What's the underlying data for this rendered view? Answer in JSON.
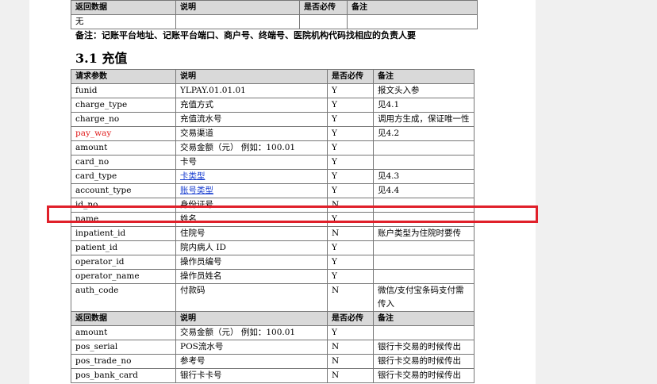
{
  "top_table": {
    "header": [
      "返回数据",
      "说明",
      "是否必传",
      "备注"
    ],
    "rows": [
      [
        "无",
        "",
        "",
        ""
      ]
    ]
  },
  "note": "备注：记账平台地址、记账平台端口、商户号、终端号、医院机构代码找相应的负责人要",
  "section_heading": "3.1 充值",
  "request_table": {
    "header": [
      "请求参数",
      "说明",
      "是否必传",
      "备注"
    ],
    "rows": [
      [
        "funid",
        "YLPAY.01.01.01",
        "Y",
        "报文头入参"
      ],
      [
        "charge_type",
        "充值方式",
        "Y",
        "见4.1"
      ],
      [
        "charge_no",
        "充值流水号",
        "Y",
        "调用方生成，保证唯一性"
      ],
      [
        "pay_way",
        "交易渠道",
        "Y",
        "见4.2"
      ],
      [
        "amount",
        "交易金额（元） 例如：100.01",
        "Y",
        ""
      ],
      [
        "card_no",
        "卡号",
        "Y",
        ""
      ],
      [
        "card_type",
        "卡类型",
        "Y",
        "见4.3"
      ],
      [
        "account_type",
        "账号类型",
        "Y",
        "见4.4"
      ],
      [
        "id_no",
        "身份证号",
        "N",
        ""
      ],
      [
        "name",
        "姓名",
        "Y",
        ""
      ],
      [
        "inpatient_id",
        "住院号",
        "N",
        "账户类型为住院时要传"
      ],
      [
        "patient_id",
        "院内病人 ID",
        "Y",
        ""
      ],
      [
        "operator_id",
        "操作员编号",
        "Y",
        ""
      ],
      [
        "operator_name",
        "操作员姓名",
        "Y",
        ""
      ],
      [
        "auth_code",
        "付款码",
        "N",
        "微信/支付宝条码支付需传入"
      ]
    ]
  },
  "return_table": {
    "header": [
      "返回数据",
      "说明",
      "是否必传",
      "备注"
    ],
    "rows": [
      [
        "amount",
        "交易金额（元） 例如：100.01",
        "Y",
        ""
      ],
      [
        "pos_serial",
        "POS流水号",
        "N",
        "银行卡交易的时候传出"
      ],
      [
        "pos_trade_no",
        "参考号",
        "N",
        "银行卡交易的时候传出"
      ],
      [
        "pos_bank_card",
        "银行卡卡号",
        "N",
        "银行卡交易的时候传出"
      ]
    ]
  },
  "colors": {
    "highlight": "#e0202a",
    "red_text": "#e02020",
    "link": "#1a3fd0",
    "header_bg": "#d9d9d9"
  }
}
